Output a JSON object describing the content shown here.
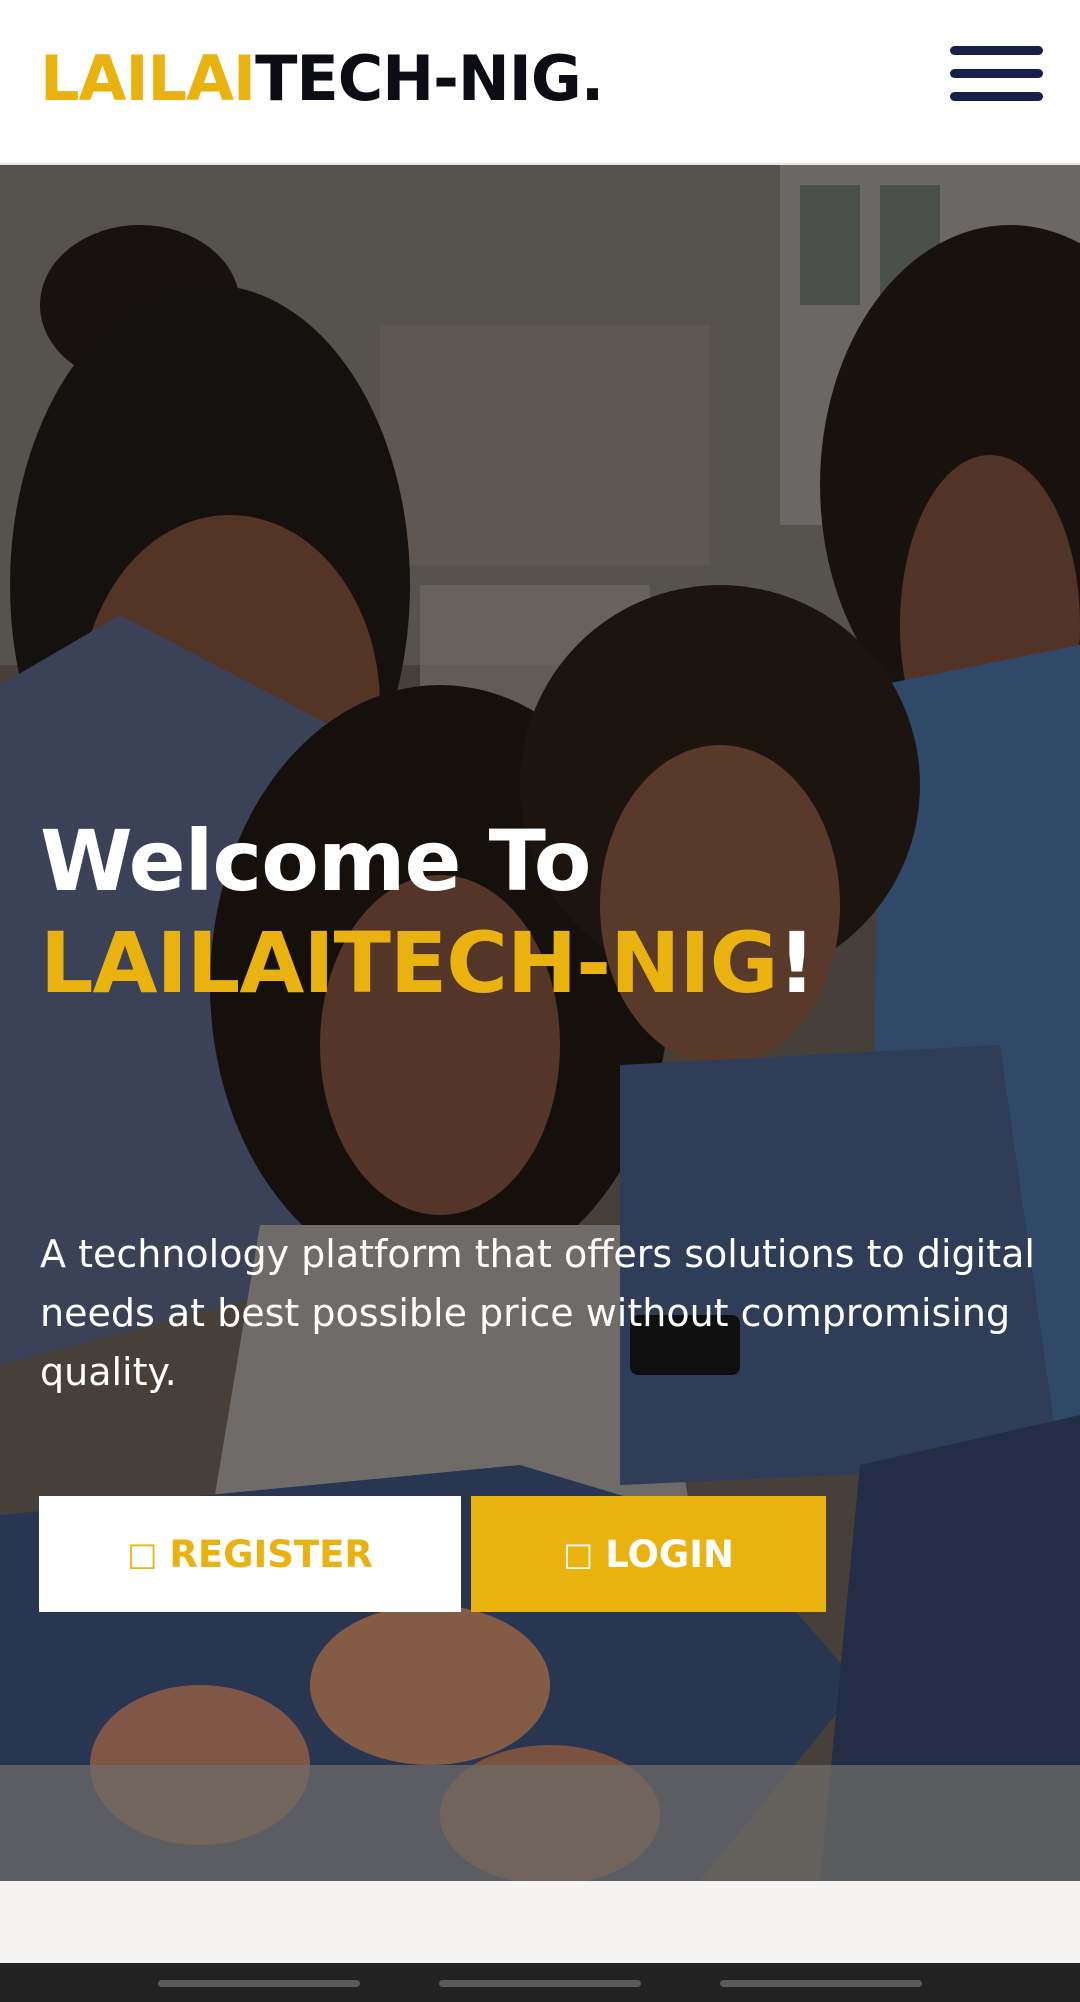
{
  "header": {
    "brand_part1": "LAILAI",
    "brand_part2": "TECH-NIG.",
    "menu_icon": "hamburger-menu-icon"
  },
  "hero": {
    "title_prefix": "Welcome To ",
    "title_brand": "LAILAITECH-NIG",
    "title_suffix": "!",
    "subtitle": "A technology platform that offers solutions to digital needs at best possible price without compromising quality.",
    "register_icon": "user-plus-icon",
    "register_label": "REGISTER",
    "login_icon": "sign-in-icon",
    "login_label": "LOGIN"
  },
  "colors": {
    "accent": "#eab20f",
    "brand_dark": "#0c0c14",
    "menu": "#16214a"
  }
}
